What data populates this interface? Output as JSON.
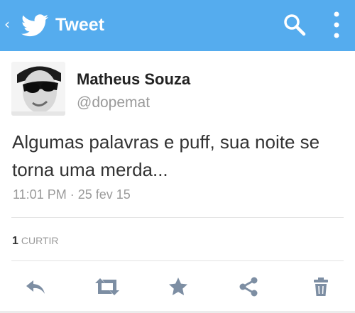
{
  "appbar": {
    "title": "Tweet",
    "color": "#55acee",
    "back_icon": "chevron-left-icon",
    "logo_icon": "twitter-bird-icon",
    "search_icon": "search-icon",
    "more_icon": "more-vertical-icon"
  },
  "tweet": {
    "display_name": "Matheus Souza",
    "username": "@dopemat",
    "text": "Algumas palavras e puff, sua noite se torna uma merda...",
    "timestamp": "11:01 PM · 25 fev 15",
    "likes_count": "1",
    "likes_label": "CURTIR"
  },
  "actions": [
    "reply-icon",
    "retweet-icon",
    "favorite-star-icon",
    "share-icon",
    "delete-trash-icon"
  ],
  "colors": {
    "action_icon": "#7d8ea3",
    "text": "#333333",
    "secondary_text": "#9a9a9a"
  }
}
